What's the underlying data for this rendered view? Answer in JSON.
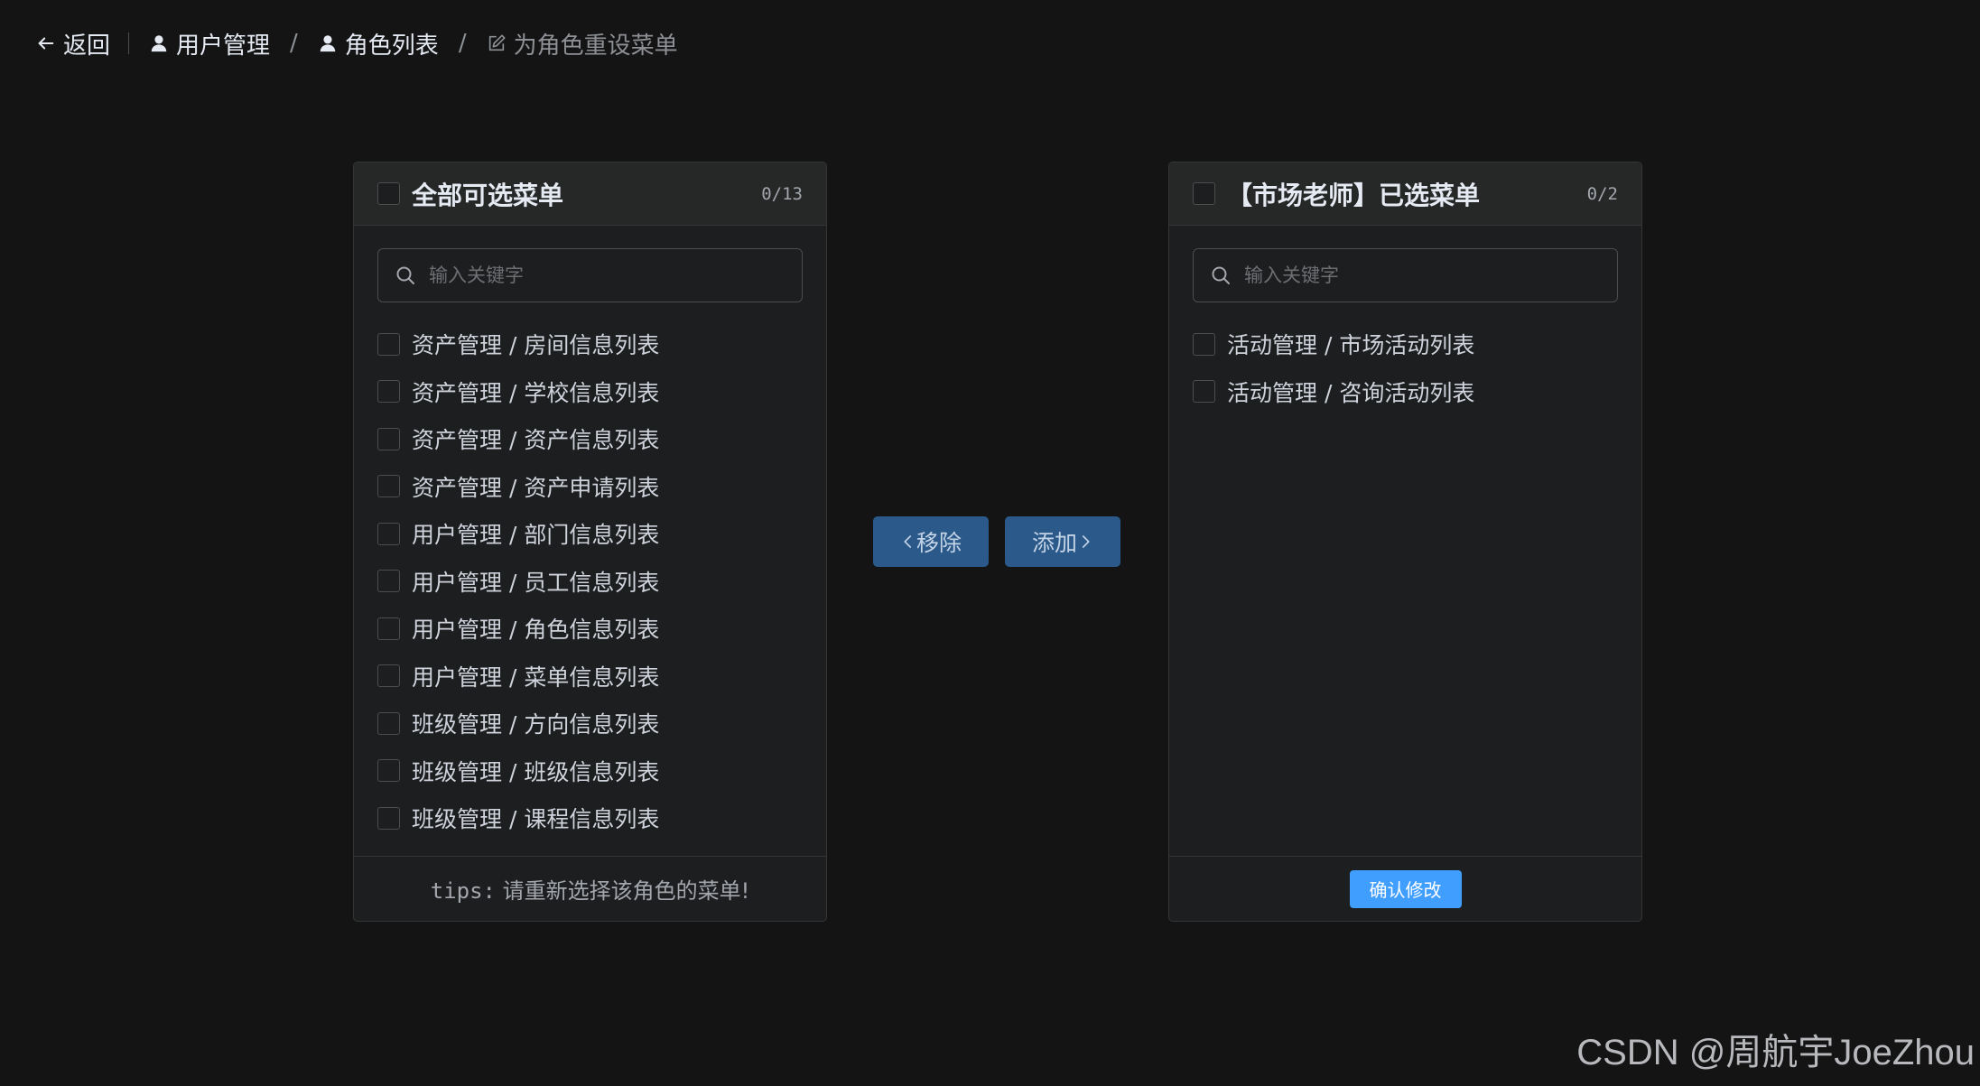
{
  "header": {
    "back_label": "返回",
    "breadcrumbs": [
      {
        "label": "用户管理",
        "icon": "user-icon"
      },
      {
        "label": "角色列表",
        "icon": "user-icon"
      },
      {
        "label": "为角色重设菜单",
        "icon": "edit-icon"
      }
    ],
    "separator": "/"
  },
  "left_panel": {
    "title": "全部可选菜单",
    "count": "0/13",
    "search_placeholder": "输入关键字",
    "items": [
      {
        "label": "资产管理 / 房间信息列表"
      },
      {
        "label": "资产管理 / 学校信息列表"
      },
      {
        "label": "资产管理 / 资产信息列表"
      },
      {
        "label": "资产管理 / 资产申请列表"
      },
      {
        "label": "用户管理 / 部门信息列表"
      },
      {
        "label": "用户管理 / 员工信息列表"
      },
      {
        "label": "用户管理 / 角色信息列表"
      },
      {
        "label": "用户管理 / 菜单信息列表"
      },
      {
        "label": "班级管理 / 方向信息列表"
      },
      {
        "label": "班级管理 / 班级信息列表"
      },
      {
        "label": "班级管理 / 课程信息列表"
      }
    ],
    "tips_prefix": "tips:",
    "tips_text": " 请重新选择该角色的菜单!"
  },
  "right_panel": {
    "title": "【市场老师】已选菜单",
    "count": "0/2",
    "search_placeholder": "输入关键字",
    "items": [
      {
        "label": "活动管理 / 市场活动列表"
      },
      {
        "label": "活动管理 / 咨询活动列表"
      }
    ],
    "confirm_label": "确认修改"
  },
  "transfer": {
    "remove_label": "移除",
    "add_label": "添加"
  },
  "watermark": "CSDN @周航宇JoeZhou",
  "colors": {
    "background": "#141414",
    "panel": "#1d1e1f",
    "primary": "#409eff",
    "transfer_button": "#2a598a"
  }
}
